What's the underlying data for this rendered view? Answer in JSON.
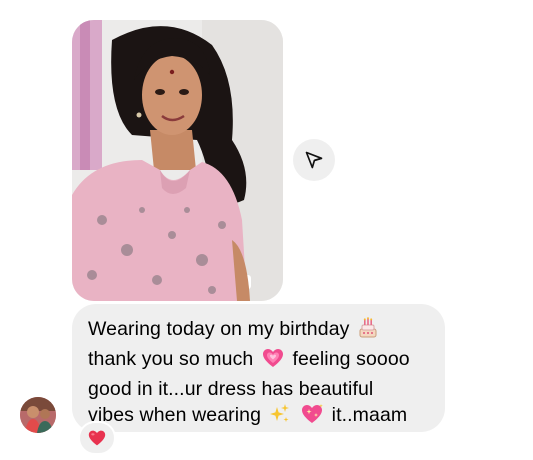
{
  "message": {
    "lines": [
      {
        "t1": "Wearing today on my birthday",
        "t2": ""
      },
      {
        "t1": "thank you so much",
        "t2": "feeling soooo"
      },
      {
        "t1": "good in it...ur dress has beautiful",
        "t2": ""
      },
      {
        "t1": "vibes when wearing",
        "t2": "it..maam"
      }
    ],
    "emojis": [
      "birthday-cake",
      "growing-heart",
      "sparkles",
      "sparkling-heart"
    ]
  },
  "attachment": {
    "type": "photo",
    "subject": "selfie"
  },
  "reaction": {
    "emoji": "red-heart"
  },
  "colors": {
    "bubble": "#efefef",
    "text": "#000000",
    "dress": "#e9b3c4",
    "heart": "#e8324f"
  }
}
